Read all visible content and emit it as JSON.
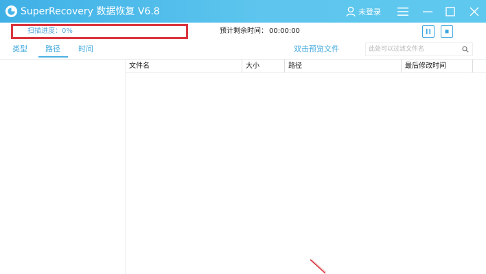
{
  "titlebar": {
    "title": "SuperRecovery 数据恢复 V6.8",
    "login_label": "未登录",
    "icons": [
      "logo-icon",
      "user-icon",
      "menu-icon",
      "minimize-icon",
      "maximize-icon",
      "close-icon"
    ]
  },
  "status": {
    "scan_progress_label": "扫描进度：",
    "scan_progress_value": "0%",
    "progress_fraction": 0,
    "remaining_label": "预计剩余时间：",
    "remaining_value": "00:00:00"
  },
  "tabs": [
    {
      "label": "类型"
    },
    {
      "label": "路径",
      "active": true
    },
    {
      "label": "时间"
    }
  ],
  "toolbar": {
    "preview_label": "双击预览文件",
    "filter_placeholder": "此处可以过滤文件名"
  },
  "table": {
    "columns": [
      "文件名",
      "大小",
      "路径",
      "最后修改时间"
    ],
    "rows": []
  },
  "colors": {
    "titlebar_start": "#3fb0e6",
    "titlebar_end": "#5fc8ee",
    "accent": "#43a9de",
    "highlight_border": "#d9363e"
  }
}
